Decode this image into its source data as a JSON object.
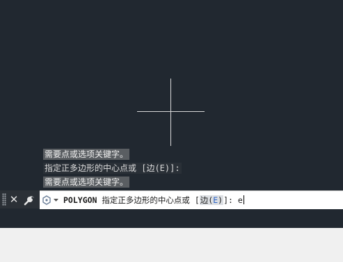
{
  "history": {
    "line1": "需要点或选项关键字。",
    "line2": "指定正多边形的中心点或 [边(E)]:",
    "line3": "需要点或选项关键字。"
  },
  "command_line": {
    "command": "POLYGON",
    "prompt_text": "指定正多边形的中心点或",
    "bracket_open": "[",
    "option_label": "边(",
    "option_key": "E",
    "option_close": ")",
    "bracket_close": "]:",
    "input_value": "e"
  },
  "icons": [
    "close-icon",
    "wrench-icon",
    "recent-commands-icon",
    "chevron-down-icon"
  ],
  "colors": {
    "canvas": "#212830",
    "crosshair": "#d8d8d8",
    "history_highlight": "#5a5e62",
    "option_key": "#2a63c7"
  }
}
